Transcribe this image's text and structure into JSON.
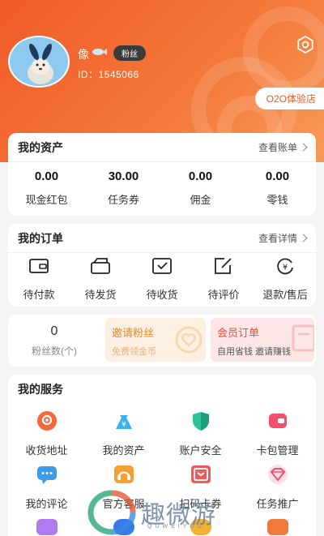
{
  "profile": {
    "username": "像",
    "badge": "粉丝",
    "id_text": "ID：1545066",
    "o2o_button": "O2O体验店"
  },
  "assets": {
    "title": "我的资产",
    "link": "查看账单",
    "items": [
      {
        "value": "0.00",
        "label": "现金红包"
      },
      {
        "value": "30.00",
        "label": "任务券"
      },
      {
        "value": "0.00",
        "label": "佣金"
      },
      {
        "value": "0.00",
        "label": "零钱"
      }
    ]
  },
  "orders": {
    "title": "我的订单",
    "link": "查看详情",
    "items": [
      {
        "label": "待付款",
        "icon": "wallet-icon"
      },
      {
        "label": "待发货",
        "icon": "package-open-icon"
      },
      {
        "label": "待收货",
        "icon": "box-check-icon"
      },
      {
        "label": "待评价",
        "icon": "edit-icon"
      },
      {
        "label": "退款/售后",
        "icon": "refund-icon"
      }
    ]
  },
  "fans": {
    "count": "0",
    "label": "粉丝数(个)",
    "invite_title": "邀请粉丝",
    "invite_sub": "免费领金币",
    "member_title": "会员订单",
    "member_sub": "自用省钱 邀请赚钱"
  },
  "services": {
    "title": "我的服务",
    "items": [
      {
        "label": "收货地址",
        "icon": "location-icon",
        "color": "#f26a3a"
      },
      {
        "label": "我的资产",
        "icon": "money-bag-icon",
        "color": "#3ab0e8"
      },
      {
        "label": "账户安全",
        "icon": "shield-icon",
        "color": "#2cc39a"
      },
      {
        "label": "卡包管理",
        "icon": "card-wallet-icon",
        "color": "#f0506e"
      },
      {
        "label": "我的评论",
        "icon": "comment-icon",
        "color": "#3a9be8"
      },
      {
        "label": "官方客服",
        "icon": "customer-service-icon",
        "color": "#f5a030"
      },
      {
        "label": "扫码卡券",
        "icon": "coupon-icon",
        "color": "#f05a5a"
      },
      {
        "label": "任务推广",
        "icon": "diamond-icon",
        "color": "#f0506e"
      }
    ]
  },
  "colors": {
    "brand": "#f05a28",
    "header_gradient_end": "#f79a5a",
    "invite_bg": "#fdf0e2",
    "invite_text": "#e08a2a",
    "member_bg": "#fde6e6",
    "member_text": "#e0503a"
  },
  "watermark": {
    "text": "趣微游",
    "sub": "QUWEIYOU"
  }
}
